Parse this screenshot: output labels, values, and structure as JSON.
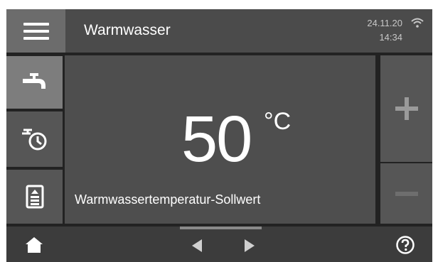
{
  "header": {
    "title": "Warmwasser",
    "date": "24.11.20",
    "time": "14:34"
  },
  "nav": {
    "items": [
      {
        "icon": "tap-icon",
        "selected": true
      },
      {
        "icon": "timer-tap-icon",
        "selected": false
      },
      {
        "icon": "document-icon",
        "selected": false
      }
    ]
  },
  "main": {
    "value": "50",
    "unit": "°C",
    "caption": "Warmwassertemperatur-Sollwert"
  },
  "controls": {
    "increase_icon": "plus-icon",
    "decrease_icon": "minus-icon"
  },
  "footer": {
    "icons": [
      "home-icon",
      "chevron-left-icon",
      "chevron-right-icon",
      "help-icon"
    ]
  },
  "colors": {
    "background": "#222222",
    "header": "#4b4b4b",
    "panel": "#4e4e4e",
    "selected_nav": "#7d7d7d",
    "text": "#ffffff"
  }
}
